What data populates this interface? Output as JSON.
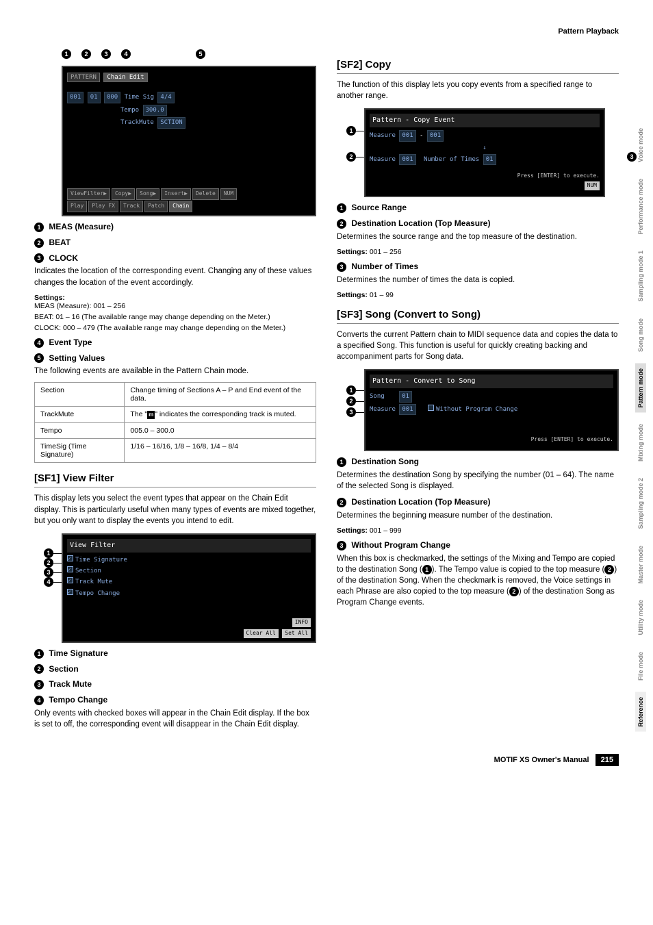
{
  "header": {
    "breadcrumb": "Pattern Playback"
  },
  "footer": {
    "book": "MOTIF XS Owner's Manual",
    "page": "215"
  },
  "side_tabs": [
    "Voice mode",
    "Performance mode",
    "Sampling mode 1",
    "Song mode",
    "Pattern mode",
    "Mixing mode",
    "Sampling mode 2",
    "Master mode",
    "Utility mode",
    "File mode",
    "Reference"
  ],
  "left": {
    "screenshot1": {
      "callouts_top": [
        "1",
        "2",
        "3",
        "4",
        "5"
      ],
      "top_tabs": [
        "PATTERN",
        "Chain Edit"
      ],
      "rows": [
        {
          "c1": "001",
          "c2": "01",
          "c3": "000",
          "lbl": "Time Sig",
          "val": "4/4"
        },
        {
          "lbl": "Tempo",
          "val": "300.0"
        },
        {
          "lbl": "TrackMute",
          "val": "SCTION"
        }
      ],
      "buttons_row": [
        "ViewFilter▶",
        "Copy▶",
        "Song▶",
        "Insert▶",
        "Delete",
        "NUM"
      ],
      "bottom_tabs": [
        "Play",
        "Play FX",
        "Track",
        "Patch",
        "Chain"
      ]
    },
    "meas": {
      "h1": "MEAS (Measure)",
      "h2": "BEAT",
      "h3": "CLOCK",
      "p1": "Indicates the location of the corresponding event. Changing any of these values changes the location of the event accordingly.",
      "settings_label": "Settings:",
      "s1": "MEAS (Measure): 001 – 256",
      "s2": "BEAT: 01 – 16 (The available range may change depending on the Meter.)",
      "s3": "CLOCK: 000 – 479 (The available range may change depending on the Meter.)"
    },
    "eventtype": {
      "h4": "Event Type",
      "h5": "Setting Values",
      "p": "The following events are available in the Pattern Chain mode.",
      "table": [
        [
          "Section",
          "Change timing of Sections A – P and End event of the data."
        ],
        [
          "TrackMute",
          "The \"m\" indicates the corresponding track is muted."
        ],
        [
          "Tempo",
          "005.0 – 300.0"
        ],
        [
          "TimeSig (Time Signature)",
          "1/16 – 16/16, 1/8 – 16/8, 1/4 – 8/4"
        ]
      ]
    },
    "sf1": {
      "title": "[SF1] View Filter",
      "p": "This display lets you select the event types that appear on the Chain Edit display. This is particularly useful when many types of events are mixed together, but you only want to display the events you intend to edit.",
      "screenshot": {
        "title": "View Filter",
        "items": [
          "Time Signature",
          "Section",
          "Track Mute",
          "Tempo Change"
        ],
        "buttons": [
          "INFO",
          "Clear All",
          "Set All"
        ]
      },
      "h1": "Time Signature",
      "h2": "Section",
      "h3": "Track Mute",
      "h4": "Tempo Change",
      "p2": "Only events with checked boxes will appear in the Chain Edit display. If the box is set to off, the corresponding event will disappear in the Chain Edit display."
    }
  },
  "right": {
    "sf2": {
      "title": "[SF2] Copy",
      "p": "The function of this display lets you copy events from a specified range to another range.",
      "screenshot": {
        "title": "Pattern - Copy Event",
        "r1_label": "Measure",
        "r1_a": "001",
        "r1_dash": "-",
        "r1_b": "001",
        "r2_label": "Measure",
        "r2_a": "001",
        "r2_nt": "Number of Times",
        "r2_b": "01",
        "press": "Press [ENTER] to execute.",
        "num": "NUM"
      },
      "h1": "Source Range",
      "h2": "Destination Location (Top Measure)",
      "p2": "Determines the source range and the top measure of the destination.",
      "s2_label": "Settings:",
      "s2": "001 – 256",
      "h3": "Number of Times",
      "p3": "Determines the number of times the data is copied.",
      "s3_label": "Settings:",
      "s3": "01 – 99"
    },
    "sf3": {
      "title": "[SF3] Song (Convert to Song)",
      "p": "Converts the current Pattern chain to MIDI sequence data and copies the data to a specified Song. This function is useful for quickly creating backing and accompaniment parts for Song data.",
      "screenshot": {
        "title": "Pattern - Convert to Song",
        "r1_label": "Song",
        "r1_val": "01",
        "r2_label": "Measure",
        "r2_val": "001",
        "r2_chk": "Without Program Change",
        "press": "Press [ENTER] to execute."
      },
      "h1": "Destination Song",
      "p1": "Determines the destination Song by specifying the number (01 – 64). The name of the selected Song is displayed.",
      "h2": "Destination Location (Top Measure)",
      "p2": "Determines the beginning measure number of the destination.",
      "s2_label": "Settings:",
      "s2": "001 – 999",
      "h3": "Without Program Change",
      "p3a": "When this box is checkmarked, the settings of the Mixing and Tempo are copied to the destination Song (",
      "p3b": "). The Tempo value is copied to the top measure (",
      "p3c": ") of the destination Song. When the checkmark is removed, the Voice settings in each Phrase are also copied to the top measure (",
      "p3d": ") of the destination Song as Program Change events."
    }
  }
}
